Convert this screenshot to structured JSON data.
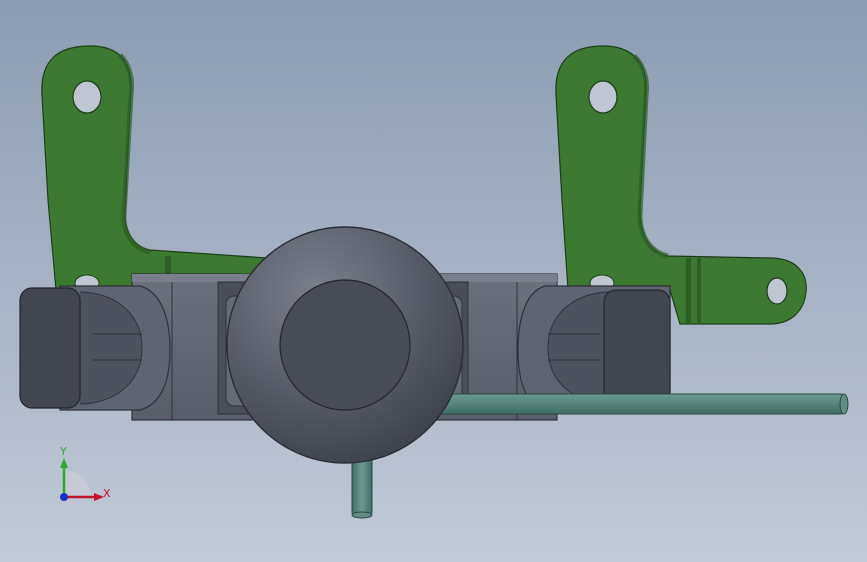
{
  "view": {
    "background_top": "#8d9cb2",
    "background_bottom": "#c2cad6"
  },
  "model": {
    "bracket_color": "#3c7a32",
    "body_color": "#5f6472",
    "pad_color": "#42464f",
    "knob_color": "#525764",
    "rod_color": "#4d7a72"
  },
  "triad": {
    "x_label": "X",
    "y_label": "Y",
    "x_color": "#c0142a",
    "y_color": "#2ea82e",
    "z_color": "#1a2fbf"
  }
}
